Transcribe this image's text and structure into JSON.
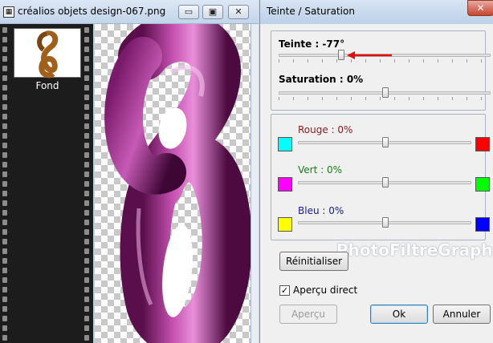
{
  "image_window": {
    "title": "créalios objets design-067.png",
    "minimize_label": "▭",
    "restore_label": "▣",
    "close_label": "✕",
    "layer_name": "Fond"
  },
  "dialog": {
    "title": "Teinte / Saturation",
    "close_label": "✕",
    "hue_label": "Teinte : -77°",
    "hue_value": -77,
    "saturation_label": "Saturation : 0%",
    "saturation_value": 0,
    "red_label": "Rouge : 0%",
    "green_label": "Vert : 0%",
    "blue_label": "Bleu : 0%",
    "reset_button": "Réinitialiser",
    "preview_checkbox_label": "Aperçu direct",
    "preview_checked": true,
    "preview_button": "Aperçu",
    "ok_button": "Ok",
    "cancel_button": "Annuler",
    "watermark": "PhotoFiltreGraphic"
  },
  "colors": {
    "cyan": "#00ffff",
    "red": "#ff0000",
    "magenta": "#ff00ff",
    "green": "#00ff00",
    "yellow": "#ffff00",
    "blue": "#0000ff",
    "red_label_color": "#8b1a1a",
    "green_label_color": "#1a7a1a",
    "blue_label_color": "#1a1a8b",
    "arrow": "#e01010",
    "sculpture": "#9a2080"
  }
}
